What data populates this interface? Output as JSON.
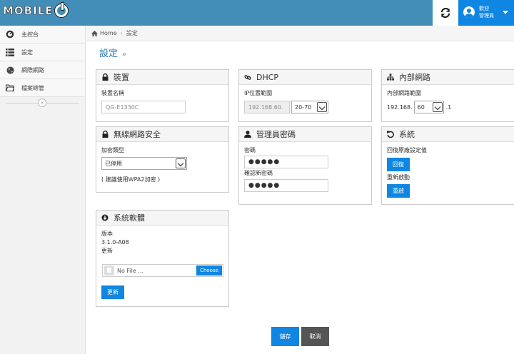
{
  "header": {
    "logo_text": "MOBILE",
    "user_line1": "歡迎",
    "user_line2": "管理員"
  },
  "breadcrumb": {
    "home": "Home",
    "current": "設定"
  },
  "page": {
    "title": "設定",
    "chevron": "»"
  },
  "sidebar": {
    "items": [
      {
        "label": "主控台",
        "icon": "dashboard-icon"
      },
      {
        "label": "設定",
        "icon": "list-icon"
      },
      {
        "label": "網際網路",
        "icon": "globe-icon"
      },
      {
        "label": "檔案總管",
        "icon": "folder-icon"
      }
    ],
    "collapse_glyph": "«"
  },
  "device": {
    "title": "裝置",
    "name_label": "裝置名稱",
    "name_value": "QG-E1330C"
  },
  "dhcp": {
    "title": "DHCP",
    "range_label": "IP位置範圍",
    "prefix": "192.168.60.",
    "range_value": "20-70"
  },
  "lan": {
    "title": "內部網路",
    "range_label": "內部網路範圍",
    "prefix": "192.168.",
    "value": "60",
    "suffix": ".1"
  },
  "wifi": {
    "title": "無線網路安全",
    "enc_label": "加密類型",
    "enc_value": "已停用",
    "hint": "( 建議使用WPA2加密 )"
  },
  "admin": {
    "title": "管理員密碼",
    "pw_label": "密碼",
    "pw_value": "●●●●●",
    "confirm_label": "確認新密碼",
    "confirm_value": "●●●●●"
  },
  "system": {
    "title": "系統",
    "restore_label": "回復原廠設定值",
    "restore_btn": "回復",
    "reboot_label": "重新啟動",
    "reboot_btn": "重啟"
  },
  "firmware": {
    "title": "系統軟體",
    "version_label": "版本",
    "version_value": "3.1.0-A08",
    "update_label": "更新",
    "file_placeholder": "No File ...",
    "choose_btn": "Choose",
    "update_btn": "更新"
  },
  "actions": {
    "save": "儲存",
    "cancel": "取消"
  },
  "colors": {
    "header": "#438eb9",
    "primary": "#0e86e2",
    "title": "#2679b5"
  }
}
